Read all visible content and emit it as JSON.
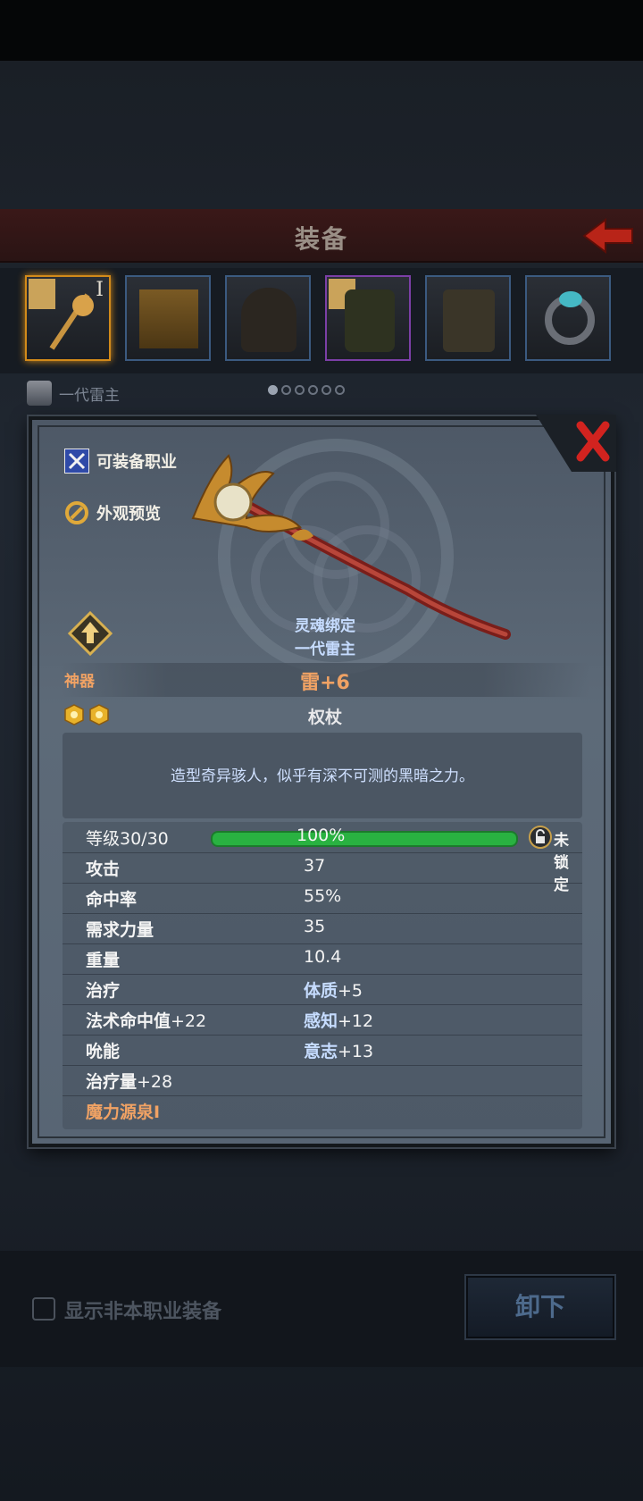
{
  "header": {
    "title": "装备"
  },
  "slots": [
    {
      "name": "staff-slot",
      "badge": "I",
      "selected": true
    },
    {
      "name": "offhand-slot"
    },
    {
      "name": "helmet-slot"
    },
    {
      "name": "armor-slot",
      "rarity": "purple"
    },
    {
      "name": "boots-slot"
    },
    {
      "name": "ring-slot"
    }
  ],
  "owner": {
    "name": "一代雷主"
  },
  "pagination": {
    "total": 6,
    "current": 1
  },
  "item": {
    "side_buttons": {
      "classes": "可装备职业",
      "preview": "外观预览"
    },
    "soul_bind": "灵魂绑定",
    "soul_owner": "一代雷主",
    "grade": "神器",
    "enhance": "雷+6",
    "type": "权杖",
    "description": "造型奇异骇人，似乎有深不可测的黑暗之力。",
    "level": {
      "label": "等级30/30",
      "percent_text": "100%",
      "progress": 1.0,
      "lock_label": "未锁定"
    },
    "stats": [
      {
        "key": "攻击",
        "value": "37"
      },
      {
        "key": "命中率",
        "value": "55%"
      },
      {
        "key": "需求力量",
        "value": "35"
      },
      {
        "key": "重量",
        "value": "10.4"
      },
      {
        "key": "治疗",
        "value_name": "体质",
        "value_num": "+5"
      },
      {
        "key_name": "法术命中值",
        "key_num": "+22",
        "value_name": "感知",
        "value_num": "+12"
      },
      {
        "key": "吮能",
        "value_name": "意志",
        "value_num": "+13"
      },
      {
        "key_name": "治疗量",
        "key_num": "+28"
      },
      {
        "key": "魔力源泉I",
        "orange": true
      }
    ]
  },
  "bottom": {
    "checkbox_label": "显示非本职业装备",
    "unequip_label": "卸下"
  },
  "colors": {
    "accent_orange": "#f0a264",
    "soul_blue": "#c6dcff",
    "progress_green": "#29b241",
    "close_red": "#d2231f"
  }
}
